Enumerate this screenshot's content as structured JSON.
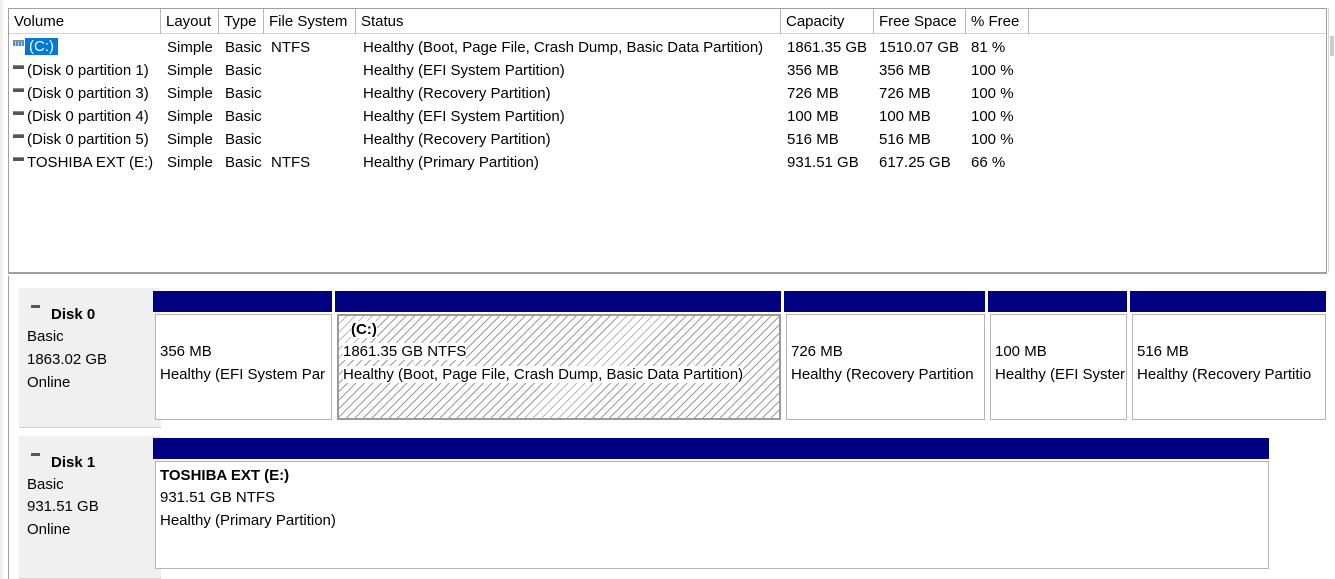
{
  "columns": [
    "Volume",
    "Layout",
    "Type",
    "File System",
    "Status",
    "Capacity",
    "Free Space",
    "% Free"
  ],
  "volumes": [
    {
      "name": "(C:)",
      "layout": "Simple",
      "type": "Basic",
      "fs": "NTFS",
      "status": "Healthy (Boot, Page File, Crash Dump, Basic Data Partition)",
      "capacity": "1861.35 GB",
      "free": "1510.07 GB",
      "pct": "81 %"
    },
    {
      "name": "(Disk 0 partition 1)",
      "layout": "Simple",
      "type": "Basic",
      "fs": "",
      "status": "Healthy (EFI System Partition)",
      "capacity": "356 MB",
      "free": "356 MB",
      "pct": "100 %"
    },
    {
      "name": "(Disk 0 partition 3)",
      "layout": "Simple",
      "type": "Basic",
      "fs": "",
      "status": "Healthy (Recovery Partition)",
      "capacity": "726 MB",
      "free": "726 MB",
      "pct": "100 %"
    },
    {
      "name": "(Disk 0 partition 4)",
      "layout": "Simple",
      "type": "Basic",
      "fs": "",
      "status": "Healthy (EFI System Partition)",
      "capacity": "100 MB",
      "free": "100 MB",
      "pct": "100 %"
    },
    {
      "name": "(Disk 0 partition 5)",
      "layout": "Simple",
      "type": "Basic",
      "fs": "",
      "status": "Healthy (Recovery Partition)",
      "capacity": "516 MB",
      "free": "516 MB",
      "pct": "100 %"
    },
    {
      "name": "TOSHIBA EXT (E:)",
      "layout": "Simple",
      "type": "Basic",
      "fs": "NTFS",
      "status": "Healthy (Primary Partition)",
      "capacity": "931.51 GB",
      "free": "617.25 GB",
      "pct": "66 %"
    }
  ],
  "disk0": {
    "name": "Disk 0",
    "type": "Basic",
    "size": "1863.02 GB",
    "state": "Online",
    "partitions": [
      {
        "title": "",
        "size": "356 MB",
        "status": "Healthy (EFI System Par"
      },
      {
        "title": "(C:)",
        "size": "1861.35 GB NTFS",
        "status": "Healthy (Boot, Page File, Crash Dump, Basic Data Partition)"
      },
      {
        "title": "",
        "size": "726 MB",
        "status": "Healthy (Recovery Partition"
      },
      {
        "title": "",
        "size": "100 MB",
        "status": "Healthy (EFI Syster"
      },
      {
        "title": "",
        "size": "516 MB",
        "status": "Healthy (Recovery Partitio"
      }
    ]
  },
  "disk1": {
    "name": "Disk 1",
    "type": "Basic",
    "size": "931.51 GB",
    "state": "Online",
    "partitions": [
      {
        "title": "TOSHIBA EXT  (E:)",
        "size": "931.51 GB NTFS",
        "status": "Healthy (Primary Partition)"
      }
    ]
  },
  "colors": {
    "partition_bar": "#000080",
    "selection": "#0078d7"
  }
}
